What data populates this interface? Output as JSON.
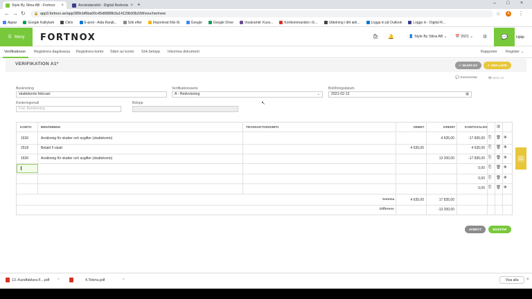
{
  "browser": {
    "tabs": [
      {
        "label": "Style By Stina AB - Fortnox",
        "favicon_color": "#78c83c",
        "active": true
      },
      {
        "label": "Användarstöd - Digital Redovisn...",
        "favicon_color": "#3b3f8c",
        "active": false
      }
    ],
    "url": "app3.fortnox.se/app/389cbf6ba00c45d6888b3a14129b93b2/bf/voucher/new",
    "bookmarks": [
      {
        "label": "Appar",
        "color": "#4285f4"
      },
      {
        "label": "Google Kalkylark",
        "color": "#0f9d58"
      },
      {
        "label": "Citrix",
        "color": "#444444"
      },
      {
        "label": "E-post - Aida Ranjb...",
        "color": "#0078d4"
      },
      {
        "label": "Sök efter",
        "color": "#888888"
      },
      {
        "label": "Importerat från IE",
        "color": "#f4b400"
      },
      {
        "label": "Google",
        "color": "#4285f4"
      },
      {
        "label": "Google Drive",
        "color": "#0f9d58"
      },
      {
        "label": "Voukramkl: Kuss...",
        "color": "#6a4c93"
      },
      {
        "label": "Kortkommandon i E...",
        "color": "#d93025"
      },
      {
        "label": "Utdelning i ditt akti...",
        "color": "#444444"
      },
      {
        "label": "Logga in på Outlook",
        "color": "#0078d4"
      },
      {
        "label": "Logga in - Digital R...",
        "color": "#3b3f8c"
      }
    ],
    "avatar_letter": "A"
  },
  "app": {
    "menu_label": "Meny",
    "logo": "FORTNOX",
    "company": "Style By Stina AB",
    "year": "2021",
    "help": "Hjälp",
    "accent": "#78c83c"
  },
  "subnav": {
    "items": [
      "Verifikationer",
      "Registrera dagskassa",
      "Registrera konto",
      "Stäm av konto",
      "Sök belopp",
      "Inkomna dokument"
    ],
    "right": [
      "Rapporter",
      "Register"
    ]
  },
  "page": {
    "title": "VERIFIKATION A1*",
    "btn_new": "SKAPA NY",
    "btn_list": "VISA LISTA",
    "comment": "Kommentar",
    "print": "Skriv ut"
  },
  "form": {
    "beskrivning_label": "Beskrivning",
    "beskrivning_value": "skattekonto februari",
    "serie_label": "Verifikationsserie",
    "serie_value": "A - Redovisning",
    "datum_label": "Bokföringsdatum",
    "datum_value": "2021-02-12",
    "konteringsmall_label": "Konteringsmall",
    "konteringsmall_placeholder": "Fxd. Benämning",
    "belopp_label": "Belopp"
  },
  "table": {
    "headers": [
      "KONTO",
      "BENÄMNING",
      "TRANSAKTIONSINFO",
      "DEBET",
      "KREDIT",
      "KONTOSALDO"
    ],
    "rows": [
      {
        "konto": "1630",
        "benamning": "Avräkning för skatter och avgifter (skattekonto)",
        "debet": "",
        "kredit": "4 635,00",
        "saldo": "-17 835,00"
      },
      {
        "konto": "2518",
        "benamning": "Betald F-skatt",
        "debet": "4 635,00",
        "kredit": "",
        "saldo": "4 635,00"
      },
      {
        "konto": "1630",
        "benamning": "Avräkning för skatter och avgifter (skattekonto)",
        "debet": "",
        "kredit": "13 200,00",
        "saldo": "-17 835,00"
      },
      {
        "konto": "",
        "benamning": "",
        "debet": "",
        "kredit": "",
        "saldo": "0,00"
      },
      {
        "konto": "",
        "benamning": "",
        "debet": "",
        "kredit": "",
        "saldo": "0,00"
      },
      {
        "konto": "",
        "benamning": "",
        "debet": "",
        "kredit": "",
        "saldo": "0,00"
      }
    ],
    "summa_label": "Summa",
    "summa_debet": "4 635,00",
    "summa_kredit": "17 835,00",
    "differens_label": "Differens",
    "differens_value": "-13 200,00"
  },
  "actions": {
    "cancel": "AVBRYT",
    "book": "BOKFÖR"
  },
  "downloads": {
    "files": [
      "13.-Kundfaktura-F....pdf",
      "4.Telenu.pdf"
    ],
    "show_all": "Visa alla"
  }
}
